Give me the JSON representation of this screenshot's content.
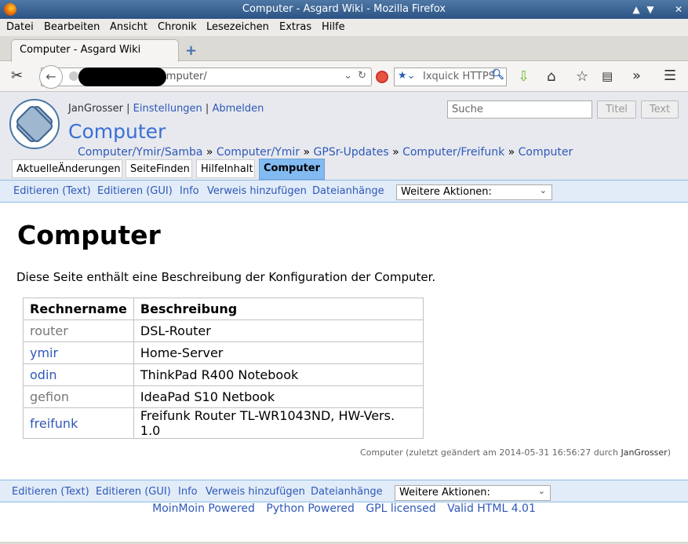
{
  "window": {
    "title": "Computer - Asgard Wiki - Mozilla Firefox",
    "controls": [
      "▲",
      "▼",
      "✕"
    ]
  },
  "menu": [
    "Datei",
    "Bearbeiten",
    "Ansicht",
    "Chronik",
    "Lesezeichen",
    "Extras",
    "Hilfe"
  ],
  "tab": {
    "title": "Computer - Asgard Wiki",
    "new_tab": "+"
  },
  "nav": {
    "url": "wiki/Computer/",
    "search_placeholder": "Ixquick HTTPS",
    "overflow": "»"
  },
  "wiki": {
    "user": "JanGrosser",
    "user_links": [
      "Einstellungen",
      "Abmelden"
    ],
    "page_title": "Computer",
    "search_placeholder": "Suche",
    "search_buttons": [
      "Titel",
      "Text"
    ],
    "breadcrumbs": [
      "Computer/Ymir/Samba",
      "Computer/Ymir",
      "GPSr-Updates",
      "Computer/Freifunk",
      "Computer"
    ],
    "nav_tabs": [
      "AktuelleÄnderungen",
      "SeiteFinden",
      "HilfeInhalt",
      "Computer"
    ],
    "actions": [
      "Editieren (Text)",
      "Editieren (GUI)",
      "Info",
      "Verweis hinzufügen",
      "Dateianhänge"
    ],
    "more_actions": "Weitere Aktionen:"
  },
  "content": {
    "heading": "Computer",
    "intro": "Diese Seite enthält eine Beschreibung der Konfiguration der Computer.",
    "table": {
      "headers": [
        "Rechnername",
        "Beschreibung"
      ],
      "rows": [
        {
          "name": "router",
          "desc": "DSL-Router",
          "linked": false
        },
        {
          "name": "ymir",
          "desc": "Home-Server",
          "linked": true
        },
        {
          "name": "odin",
          "desc": "ThinkPad R400 Notebook",
          "linked": true
        },
        {
          "name": "gefion",
          "desc": "IdeaPad S10 Netbook",
          "linked": false
        },
        {
          "name": "freifunk",
          "desc": "Freifunk Router TL-WR1043ND, HW-Vers. 1.0",
          "linked": true
        }
      ]
    },
    "pageinfo_prefix": "Computer (zuletzt geändert am 2014-05-31 16:56:27 durch ",
    "pageinfo_user": "JanGrosser",
    "pageinfo_suffix": ")"
  },
  "footer": [
    "MoinMoin Powered",
    "Python Powered",
    "GPL licensed",
    "Valid HTML 4.01"
  ],
  "colors": {
    "link": "#2f58b8",
    "title": "#3a6fd6",
    "active_tab": "#81bbf2",
    "action_bar": "#e1ecf8"
  }
}
